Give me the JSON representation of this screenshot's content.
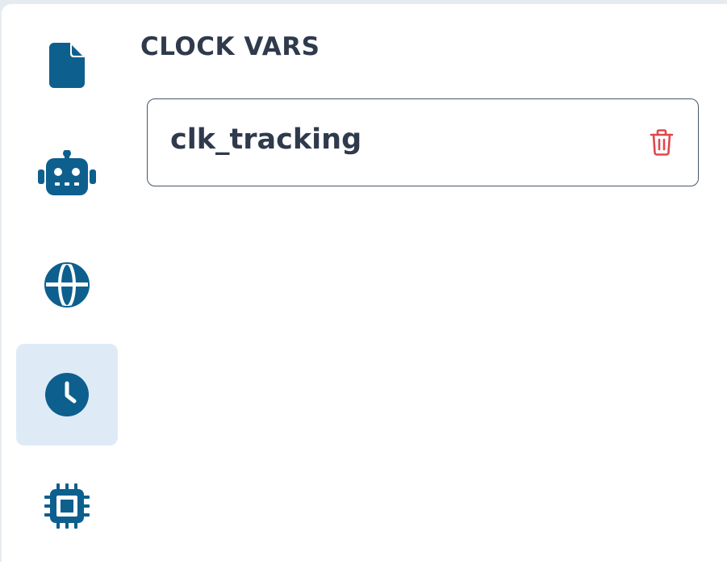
{
  "sidebar": {
    "items": [
      {
        "id": "file",
        "icon": "file-icon",
        "active": false
      },
      {
        "id": "robot",
        "icon": "robot-icon",
        "active": false
      },
      {
        "id": "globe",
        "icon": "globe-icon",
        "active": false
      },
      {
        "id": "clock",
        "icon": "clock-icon",
        "active": true
      },
      {
        "id": "chip",
        "icon": "chip-icon",
        "active": false
      }
    ]
  },
  "main": {
    "title": "CLOCK VARS",
    "vars": [
      {
        "name": "clk_tracking"
      }
    ]
  },
  "colors": {
    "icon": "#0d5f8e",
    "active_bg": "#deebf7",
    "text": "#2f3a4c",
    "delete": "#e0474c"
  }
}
